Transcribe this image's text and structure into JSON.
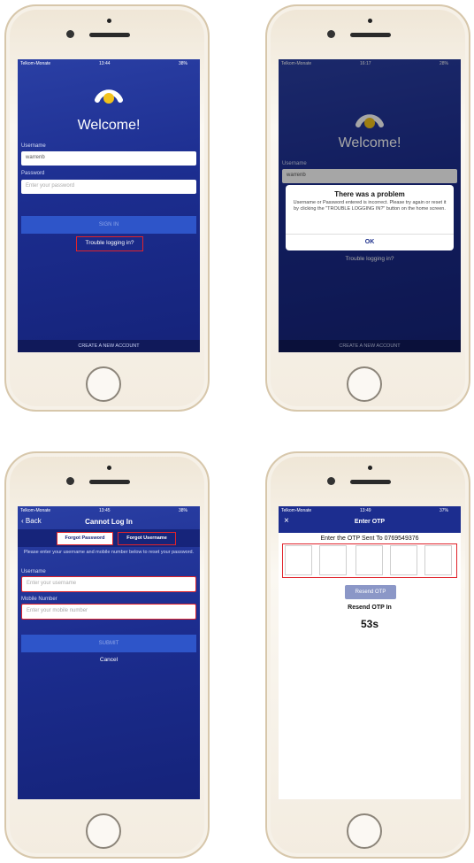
{
  "screen1": {
    "status": {
      "carrier": "Telkom-Monate",
      "time": "13:44",
      "battery": "38%"
    },
    "welcome": "Welcome!",
    "username_label": "Username",
    "username_value": "warrenb",
    "password_label": "Password",
    "password_placeholder": "Enter your password",
    "sign_in": "SIGN IN",
    "trouble": "Trouble logging in?",
    "create_account": "CREATE A NEW ACCOUNT"
  },
  "screen2": {
    "status": {
      "carrier": "Telkom-Monate",
      "time": "16:17",
      "battery": "28%"
    },
    "welcome": "Welcome!",
    "username_label": "Username",
    "username_value": "warrenb",
    "dialog_title": "There was a problem",
    "dialog_message": "Username or Password entered is incorrect. Please try again or reset it by clicking the \"TROUBLE LOGGING IN?\" button on the home screen.",
    "dialog_ok": "OK",
    "trouble": "Trouble logging in?",
    "create_account": "CREATE A NEW ACCOUNT"
  },
  "screen3": {
    "status": {
      "carrier": "Telkom-Monate",
      "time": "13:45",
      "battery": "38%"
    },
    "back": "Back",
    "title": "Cannot Log In",
    "tab_forgot_password": "Forgot Password",
    "tab_forgot_username": "Forgot Username",
    "instructions": "Please enter your username and mobile number below to reset your password.",
    "username_label": "Username",
    "username_placeholder": "Enter your username",
    "mobile_label": "Mobile Number",
    "mobile_placeholder": "Enter your mobile number",
    "submit": "SUBMIT",
    "cancel": "Cancel"
  },
  "screen4": {
    "status": {
      "carrier": "Telkom-Monate",
      "time": "13:49",
      "battery": "37%"
    },
    "close": "×",
    "title": "Enter OTP",
    "otp_prompt": "Enter the OTP Sent To 0769549376",
    "resend_button": "Resend OTP",
    "resend_in": "Resend OTP In",
    "countdown": "53s"
  },
  "colors": {
    "brand_blue": "#1c2d8f",
    "accent_yellow": "#f2c21b",
    "highlight_red": "#e0232b"
  }
}
